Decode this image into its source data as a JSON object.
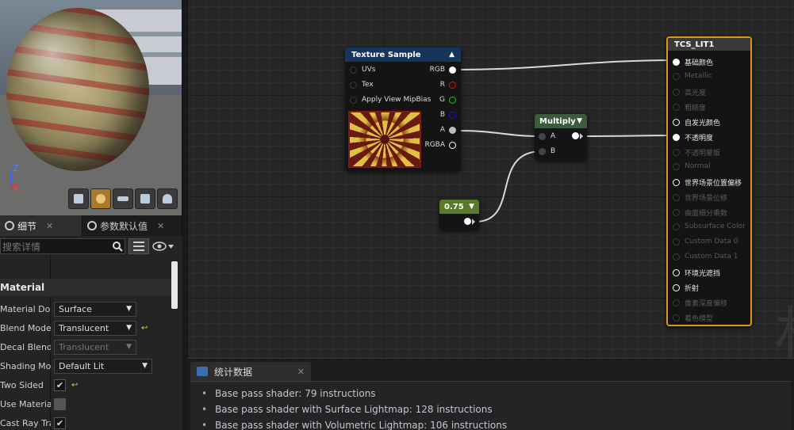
{
  "viewport": {
    "axis_z": "Z",
    "axis_x": "X",
    "buttons": [
      "cylinder-preview-icon",
      "sphere-preview-icon",
      "plane-preview-icon",
      "cube-preview-icon",
      "teapot-preview-icon"
    ],
    "active_button": 1
  },
  "details": {
    "tabs": [
      {
        "label": "细节",
        "active": true
      },
      {
        "label": "参数默认值",
        "active": false
      }
    ],
    "search_placeholder": "搜索详情",
    "category": "Material",
    "properties": [
      {
        "label": "Material Domain",
        "type": "combo",
        "value": "Surface"
      },
      {
        "label": "Blend Mode",
        "type": "combo",
        "value": "Translucent",
        "reset": true
      },
      {
        "label": "Decal Blend Mode",
        "type": "combo",
        "value": "Translucent",
        "disabled": true
      },
      {
        "label": "Shading Model",
        "type": "combo",
        "value": "Default Lit",
        "wide": true
      },
      {
        "label": "Two Sided",
        "type": "check",
        "checked": true,
        "reset": true
      },
      {
        "label": "Use Material Attributes",
        "type": "check",
        "checked": false,
        "gray": true
      },
      {
        "label": "Cast Ray Traced Shadows",
        "type": "check",
        "checked": true
      }
    ]
  },
  "graph": {
    "texture_node": {
      "title": "Texture Sample",
      "inputs": [
        "UVs",
        "Tex",
        "Apply View MipBias"
      ],
      "outputs": [
        "RGB",
        "R",
        "G",
        "B",
        "A",
        "RGBA"
      ]
    },
    "multiply_node": {
      "title": "Multiply",
      "inputs": [
        "A",
        "B"
      ]
    },
    "constant_node": {
      "title": "0.75"
    },
    "result_node": {
      "title": "TCS_LIT1",
      "pins": [
        {
          "label": "基础颜色",
          "active": true,
          "connected": true
        },
        {
          "label": "Metallic",
          "active": false
        },
        {
          "label": "高光度",
          "active": false
        },
        {
          "label": "粗糙度",
          "active": false
        },
        {
          "label": "自发光颜色",
          "active": true
        },
        {
          "label": "不透明度",
          "active": true,
          "connected": true
        },
        {
          "label": "不透明蒙版",
          "active": false
        },
        {
          "label": "Normal",
          "active": false
        },
        {
          "label": "世界场景位置偏移",
          "active": true
        },
        {
          "label": "世界场景位移",
          "active": false
        },
        {
          "label": "曲面细分乘数",
          "active": false
        },
        {
          "label": "Subsurface Color",
          "active": false
        },
        {
          "label": "Custom Data 0",
          "active": false
        },
        {
          "label": "Custom Data 1",
          "active": false
        },
        {
          "label": "环境光遮挡",
          "active": true
        },
        {
          "label": "折射",
          "active": true
        },
        {
          "label": "像素深度偏移",
          "active": false
        },
        {
          "label": "着色模型",
          "active": false
        }
      ]
    },
    "watermark": "村"
  },
  "stats": {
    "tab_label": "统计数据",
    "lines": [
      "Base pass shader: 79 instructions",
      "Base pass shader with Surface Lightmap: 128 instructions",
      "Base pass shader with Volumetric Lightmap: 106 instructions"
    ]
  },
  "colors": {
    "texture_header": "#16355a",
    "multiply_header": "#3c5a3c",
    "constant_header": "#587a2a",
    "result_header": "#3a3a3a",
    "result_border": "#e0941a"
  }
}
